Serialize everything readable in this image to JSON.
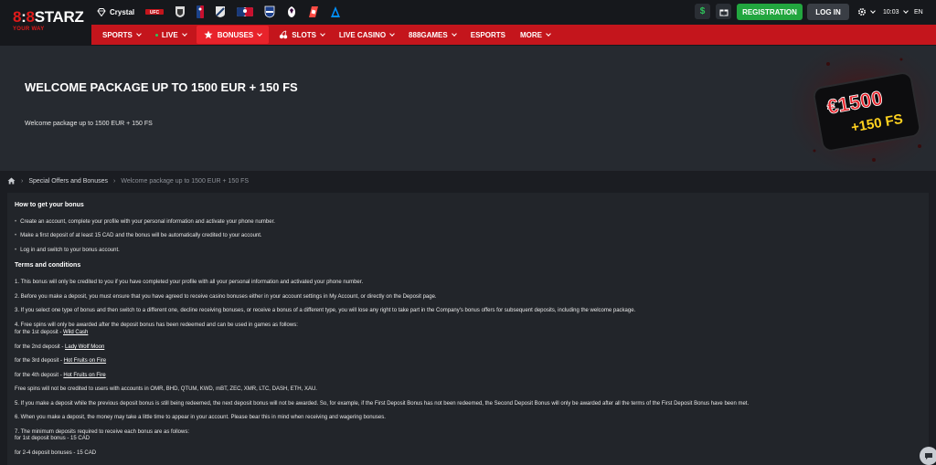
{
  "brand": {
    "logo_main_a": "8",
    "logo_main_b": "8",
    "logo_main_c": "STARZ",
    "logo_sub": "YOUR WAY",
    "accent": "#c4151c"
  },
  "top_icons": [
    {
      "name": "crystal-icon",
      "label": "Crystal"
    },
    {
      "name": "ufc-icon"
    },
    {
      "name": "nhl-icon"
    },
    {
      "name": "nba-icon"
    },
    {
      "name": "mls-icon"
    },
    {
      "name": "mlb-icon"
    },
    {
      "name": "nfl-icon"
    },
    {
      "name": "premier-league-icon"
    },
    {
      "name": "laliga-icon"
    },
    {
      "name": "alpine-icon"
    }
  ],
  "header": {
    "wallet_symbol": "$",
    "registration": "REGISTRATION",
    "login": "LOG IN",
    "time": "10:03",
    "language": "EN"
  },
  "nav": [
    {
      "label": "SPORTS",
      "chevron": true
    },
    {
      "label": "LIVE",
      "chevron": true,
      "dot": true
    },
    {
      "label": "BONUSES",
      "chevron": true,
      "active": true
    },
    {
      "label": "SLOTS",
      "chevron": true
    },
    {
      "label": "LIVE CASINO",
      "chevron": true
    },
    {
      "label": "888GAMES",
      "chevron": true
    },
    {
      "label": "ESPORTS",
      "chevron": false
    },
    {
      "label": "MORE",
      "chevron": true
    }
  ],
  "banner": {
    "title": "WELCOME PACKAGE UP TO 1500 EUR + 150 FS",
    "subtitle": "Welcome package up to 1500 EUR + 150 FS",
    "art_amount": "€1500",
    "art_fs": "+150 FS"
  },
  "breadcrumb": {
    "level1": "Special Offers and Bonuses",
    "current": "Welcome package up to 1500 EUR + 150 FS"
  },
  "content": {
    "how_title": "How to get your bonus",
    "how_steps": [
      "Create an account, complete your profile with your personal information and activate your phone number.",
      "Make a first deposit of at least 15 CAD and the bonus will be automatically credited to your account.",
      "Log in and switch to your bonus account."
    ],
    "terms_title": "Terms and conditions",
    "t1": "1. This bonus will only be credited to you if you have completed your profile with all your personal information and activated your phone number.",
    "t2": "2. Before you make a deposit, you must ensure that you have agreed to receive casino bonuses either in your account settings in My Account, or directly on the Deposit page.",
    "t3": "3. If you select one type of bonus and then switch to a different one, decline receiving bonuses, or receive a bonus of a different type, you will lose any right to take part in the Company's bonus offers for subsequent deposits, including the welcome package.",
    "t4": "4. Free spins will only be awarded after the deposit bonus has been redeemed and can be used in games as follows:",
    "fs": [
      {
        "prefix": "for the 1st deposit - ",
        "game": "Wild Cash"
      },
      {
        "prefix": "for the 2nd deposit - ",
        "game": "Lady Wolf Moon"
      },
      {
        "prefix": "for the 3rd deposit - ",
        "game": "Hot Fruits on Fire"
      },
      {
        "prefix": "for the 4th deposit - ",
        "game": "Hot Fruits on Fire"
      }
    ],
    "fs_note": "Free spins will not be credited to users with accounts in OMR, BHD, QTUM, KWD, mBT, ZEC, XMR, LTC, DASH, ETH, XAU.",
    "t5": "5. If you make a deposit while the previous deposit bonus is still being redeemed, the next deposit bonus will not be awarded. So, for example, if the First Deposit Bonus has not been redeemed, the Second Deposit Bonus will only be awarded after all the terms of the First Deposit Bonus have been met.",
    "t6": "6. When you make a deposit, the money may take a little time to appear in your account. Please bear this in mind when receiving and wagering bonuses.",
    "t7": "7. The minimum deposits required to receive each bonus are as follows:",
    "t7a": "for 1st deposit bonus - 15 CAD",
    "t7b": "for 2-4 deposit bonuses - 15 CAD"
  }
}
